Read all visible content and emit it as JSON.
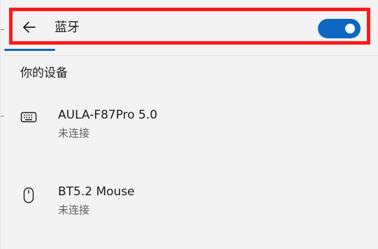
{
  "header": {
    "title": "蓝牙",
    "bluetooth_enabled": true,
    "highlight_color": "#ff1a1a",
    "accent_color": "#0b67c2",
    "back_icon": "arrow-left-icon"
  },
  "section": {
    "title": "你的设备"
  },
  "devices": [
    {
      "name": "AULA-F87Pro 5.0",
      "status": "未连接",
      "icon": "keyboard-icon"
    },
    {
      "name": "BT5.2 Mouse",
      "status": "未连接",
      "icon": "mouse-icon"
    }
  ]
}
